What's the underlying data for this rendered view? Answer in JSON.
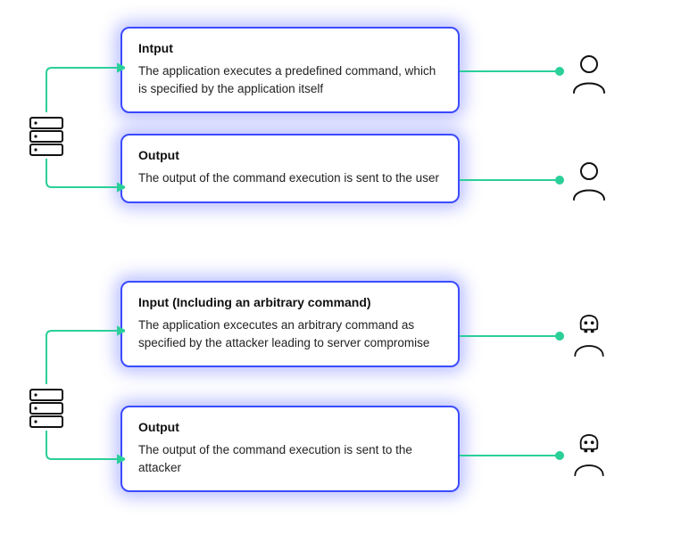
{
  "top": {
    "input": {
      "title": "Intput",
      "body": "The application executes a predefined command, which is specified by the application itself"
    },
    "output": {
      "title": "Output",
      "body": "The output of the command execution is sent to the user"
    },
    "actor": "user"
  },
  "bottom": {
    "input": {
      "title": "Input (Including an arbitrary command)",
      "body": "The application excecutes an arbitrary command as specified by the attacker leading to server compromise"
    },
    "output": {
      "title": "Output",
      "body": "The output of the command execution is sent to the attacker"
    },
    "actor": "attacker"
  }
}
